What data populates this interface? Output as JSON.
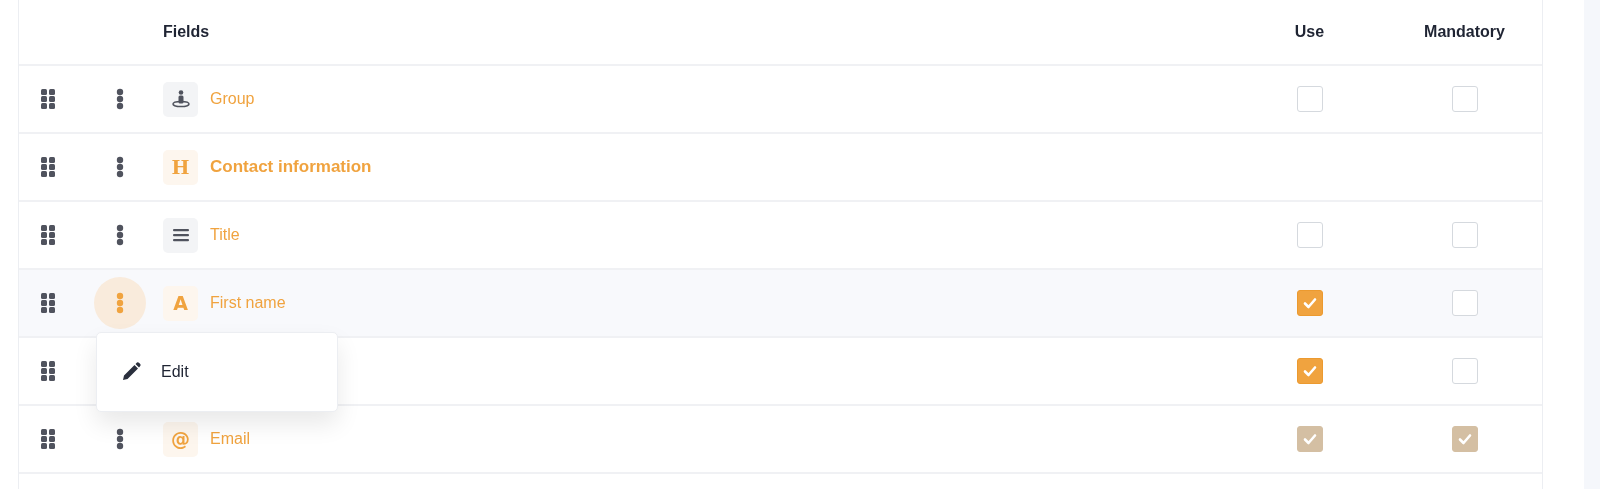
{
  "table": {
    "columns": {
      "fields": "Fields",
      "use": "Use",
      "mandatory": "Mandatory"
    },
    "rows": [
      {
        "kind": "group",
        "label": "Group",
        "menu_open": false,
        "use": {
          "checked": false,
          "disabled": false
        },
        "mandatory": {
          "checked": false,
          "disabled": false
        }
      },
      {
        "kind": "heading",
        "glyph": "H",
        "label": "Contact information",
        "menu_open": false
      },
      {
        "kind": "choice",
        "label": "Title",
        "menu_open": false,
        "use": {
          "checked": false,
          "disabled": false
        },
        "mandatory": {
          "checked": false,
          "disabled": false
        }
      },
      {
        "kind": "text",
        "glyph": "A",
        "label": "First name",
        "menu_open": true,
        "use": {
          "checked": true,
          "disabled": false
        },
        "mandatory": {
          "checked": false,
          "disabled": false
        }
      },
      {
        "kind": "covered",
        "use": {
          "checked": true,
          "disabled": false
        },
        "mandatory": {
          "checked": false,
          "disabled": false
        }
      },
      {
        "kind": "email",
        "glyph": "@",
        "label": "Email",
        "menu_open": false,
        "use": {
          "checked": true,
          "disabled": true
        },
        "mandatory": {
          "checked": true,
          "disabled": true
        }
      }
    ]
  },
  "menu": {
    "items": [
      {
        "label": "Edit"
      }
    ]
  }
}
